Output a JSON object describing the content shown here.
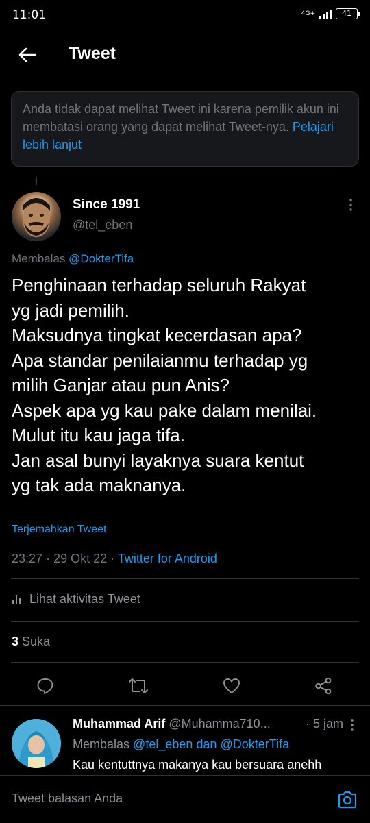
{
  "status_bar": {
    "time": "11:01",
    "network": "4G+",
    "battery": "41"
  },
  "header": {
    "title": "Tweet",
    "back_icon": "arrow-left-icon"
  },
  "notice": {
    "text": "Anda tidak dapat melihat Tweet ini karena pemilik akun ini membatasi orang yang dapat melihat Tweet-nya.",
    "link": "Pelajari lebih lanjut"
  },
  "tweet": {
    "author_name": "Since 1991",
    "author_handle": "@tel_eben",
    "replying_prefix": "Membalas",
    "replying_to": "@DokterTifa",
    "lines": [
      "Penghinaan terhadap seluruh Rakyat",
      "yg jadi pemilih.",
      "Maksudnya tingkat kecerdasan apa?",
      "Apa standar penilaianmu terhadap yg",
      "milih Ganjar atau pun Anis?",
      "Aspek apa yg kau pake dalam menilai.",
      "Mulut itu kau jaga tifa.",
      "Jan asal bunyi layaknya suara kentut",
      "yg tak ada maknanya."
    ],
    "translate": "Terjemahkan Tweet",
    "time": "23:27",
    "date": "29 Okt 22",
    "source": "Twitter for Android",
    "activity": "Lihat aktivitas Tweet",
    "likes_count": "3",
    "likes_label": "Suka"
  },
  "reply": {
    "name": "Muhammad Arif",
    "handle": "@Muhamma710...",
    "time": "5 jam",
    "replying_prefix": "Membalas",
    "replying_to_1": "@tel_eben",
    "replying_and": "dan",
    "replying_to_2": "@DokterTifa",
    "text": "Kau kentuttnya makanya kau bersuara anehh"
  },
  "composer": {
    "placeholder": "Tweet balasan Anda"
  },
  "colors": {
    "background": "#000000",
    "accent": "#1d9bf0",
    "muted": "#71767b",
    "border": "#2f3336"
  }
}
